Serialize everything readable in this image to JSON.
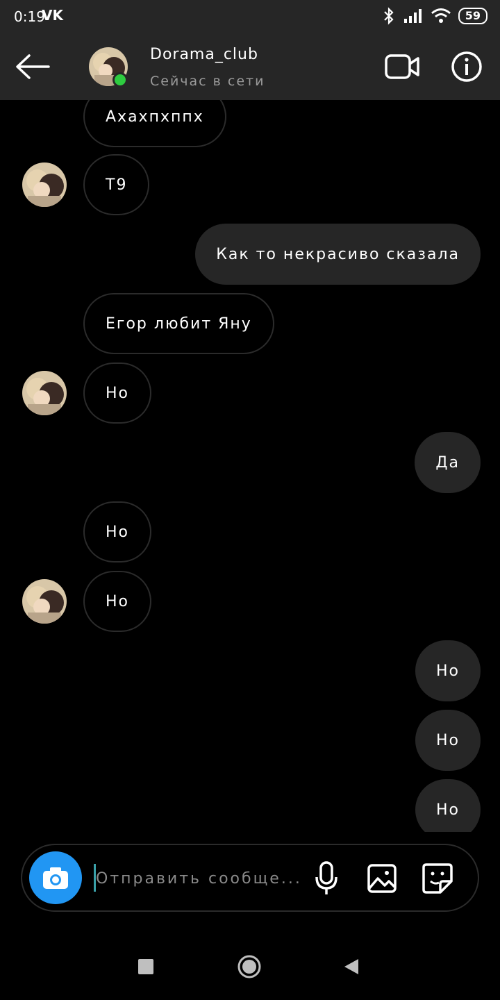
{
  "status_bar": {
    "time": "0:19",
    "app_icon": "vk-icon",
    "battery": "59",
    "icons": [
      "bluetooth-icon",
      "signal-icon",
      "wifi-icon",
      "battery-icon"
    ]
  },
  "header": {
    "name": "Dorama_club",
    "status": "Сейчас в сети",
    "online_color": "#2ecc40"
  },
  "messages": [
    {
      "side": "in",
      "text": "Ахахпхппх"
    },
    {
      "side": "in",
      "text": "Т9",
      "avatar": true
    },
    {
      "side": "out",
      "text": "Как то некрасиво сказала"
    },
    {
      "side": "in",
      "text": "Егор любит Яну"
    },
    {
      "side": "in",
      "text": "Но",
      "avatar": true
    },
    {
      "side": "out",
      "text": "Да"
    },
    {
      "side": "in",
      "text": "Но"
    },
    {
      "side": "in",
      "text": "Но",
      "avatar": true
    },
    {
      "side": "out",
      "text": "Но"
    },
    {
      "side": "out",
      "text": "Но"
    },
    {
      "side": "out",
      "text": "Но"
    }
  ],
  "composer": {
    "placeholder": "Отправить сообще...",
    "accent": "#2196f3"
  },
  "colors": {
    "background": "#000000",
    "bar": "#262626",
    "outgoing_bubble": "#262626",
    "incoming_border": "#2b2b2b"
  }
}
